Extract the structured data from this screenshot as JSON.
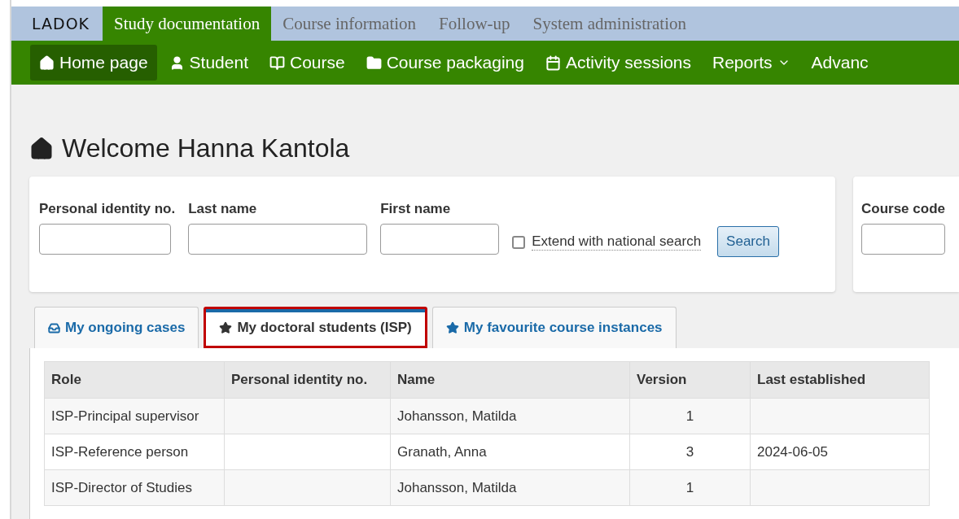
{
  "top_bar": {
    "logo": "LADOK",
    "sections": [
      {
        "label": "Study documentation",
        "selected": true
      },
      {
        "label": "Course information",
        "selected": false
      },
      {
        "label": "Follow-up",
        "selected": false
      },
      {
        "label": "System administration",
        "selected": false
      }
    ]
  },
  "nav": [
    {
      "label": "Home page",
      "kind": "home",
      "selected": true
    },
    {
      "label": "Student",
      "kind": "user",
      "selected": false
    },
    {
      "label": "Course",
      "kind": "book",
      "selected": false
    },
    {
      "label": "Course packaging",
      "kind": "folder",
      "selected": false
    },
    {
      "label": "Activity sessions",
      "kind": "calendar",
      "selected": false
    },
    {
      "label": "Reports",
      "kind": "menu",
      "selected": false
    },
    {
      "label": "Advanc",
      "kind": "plain",
      "selected": false
    }
  ],
  "heading": "Welcome Hanna Kantola",
  "search": {
    "fields": [
      {
        "label": "Personal identity no."
      },
      {
        "label": "Last name"
      },
      {
        "label": "First name"
      }
    ],
    "checkbox": {
      "label": "Extend with national search",
      "checked": false
    },
    "button": "Search"
  },
  "course_search": {
    "label": "Course code"
  },
  "tabs": [
    {
      "label": "My ongoing cases",
      "kind": "cases",
      "selected": false,
      "highlighted": false
    },
    {
      "label": "My doctoral students (ISP)",
      "kind": "favourite",
      "selected": true,
      "highlighted": true
    },
    {
      "label": "My favourite course instances",
      "kind": "favourite",
      "selected": false,
      "highlighted": false
    }
  ],
  "table": {
    "columns": [
      "Role",
      "Personal identity no.",
      "Name",
      "Version",
      "Last established"
    ],
    "rows": [
      [
        "ISP-Principal supervisor",
        "",
        "Johansson, Matilda",
        "1",
        ""
      ],
      [
        "ISP-Reference person",
        "",
        "Granath, Anna",
        "3",
        "2024-06-05"
      ],
      [
        "ISP-Director of Studies",
        "",
        "Johansson, Matilda",
        "1",
        ""
      ]
    ]
  }
}
